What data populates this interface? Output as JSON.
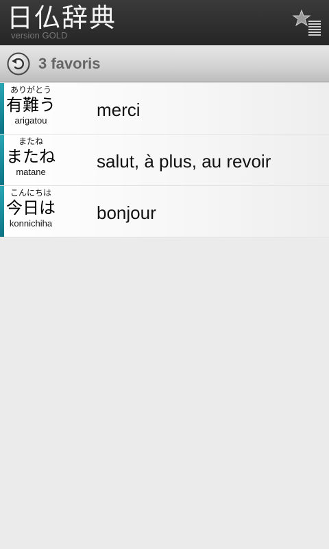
{
  "header": {
    "title": "日仏辞典",
    "version": "version GOLD",
    "favorites_icon": "star-list-icon"
  },
  "toolbar": {
    "back_icon": "back-arrow-icon",
    "title": "3 favoris"
  },
  "favorites": [
    {
      "furigana": "ありがとう",
      "kanji": "有難う",
      "romaji": "arigatou",
      "translation": "merci"
    },
    {
      "furigana": "またね",
      "kanji": "またね",
      "romaji": "matane",
      "translation": "salut, à plus, au revoir"
    },
    {
      "furigana": "こんにちは",
      "kanji": "今日は",
      "romaji": "konnichiha",
      "translation": "bonjour"
    }
  ],
  "colors": {
    "header_bg": "#2e2e2e",
    "accent": "#1a8f9e",
    "toolbar_text": "#666666",
    "background": "#ebebeb"
  }
}
